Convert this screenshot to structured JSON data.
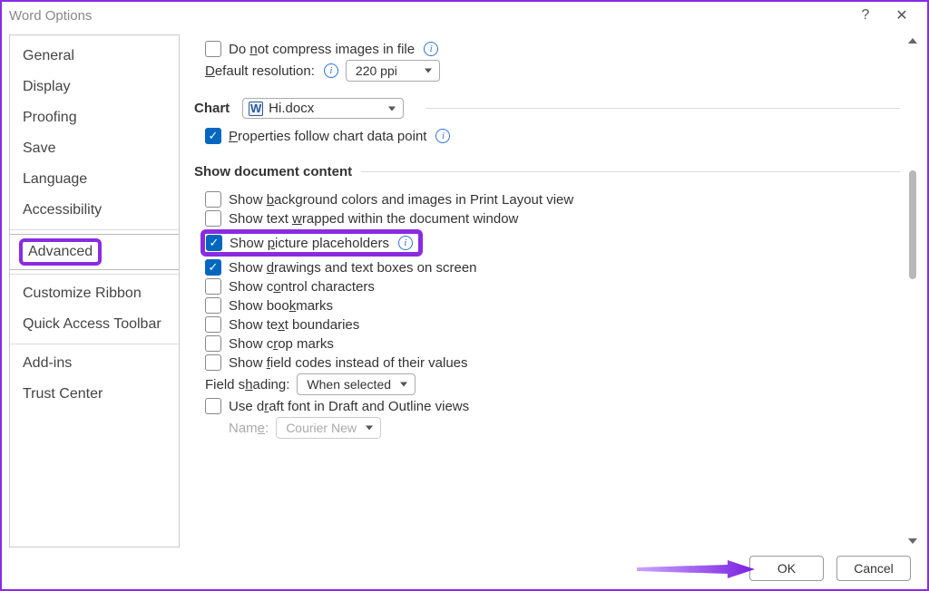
{
  "title": "Word Options",
  "titlebar": {
    "help": "?",
    "close": "✕"
  },
  "sidebar": {
    "items": [
      {
        "label": "General"
      },
      {
        "label": "Display"
      },
      {
        "label": "Proofing"
      },
      {
        "label": "Save"
      },
      {
        "label": "Language"
      },
      {
        "label": "Accessibility"
      },
      {
        "label": "Advanced",
        "selected": true,
        "highlighted": true
      },
      {
        "label": "Customize Ribbon"
      },
      {
        "label": "Quick Access Toolbar"
      },
      {
        "label": "Add-ins"
      },
      {
        "label": "Trust Center"
      }
    ]
  },
  "content": {
    "compress": {
      "label_prefix": "Do ",
      "label_accel": "n",
      "label_suffix": "ot compress images in file"
    },
    "default_res": {
      "label_accel": "D",
      "label_rest": "efault resolution:",
      "value": "220 ppi"
    },
    "chart_section": {
      "title": "Chart",
      "doc": "Hi.docx",
      "prop_prefix": "",
      "prop_accel": "P",
      "prop_rest": "roperties follow chart data point"
    },
    "doc_content_title": "Show document content",
    "checks": {
      "bg": {
        "pre": "Show ",
        "acc": "b",
        "post": "ackground colors and images in Print Layout view"
      },
      "wrap": {
        "pre": "Show text ",
        "acc": "w",
        "post": "rapped within the document window"
      },
      "pic": {
        "pre": "Show ",
        "acc": "p",
        "post": "icture placeholders"
      },
      "draw": {
        "pre": "Show ",
        "acc": "d",
        "post": "rawings and text boxes on screen"
      },
      "ctrl": {
        "pre": "Show c",
        "acc": "o",
        "post": "ntrol characters"
      },
      "bkmk": {
        "pre": "Show boo",
        "acc": "k",
        "post": "marks"
      },
      "bound": {
        "pre": "Show te",
        "acc": "x",
        "post": "t boundaries"
      },
      "crop": {
        "pre": "Show c",
        "acc": "r",
        "post": "op marks"
      },
      "field": {
        "pre": "Show ",
        "acc": "f",
        "post": "ield codes instead of their values"
      }
    },
    "field_shading": {
      "label_pre": "Field s",
      "label_acc": "h",
      "label_post": "ading:",
      "value": "When selected"
    },
    "draft_font": {
      "pre": "Use d",
      "acc": "r",
      "post": "aft font in Draft and Outline views"
    },
    "font_name": {
      "label_pre": "Nam",
      "label_acc": "e",
      "label_post": ":",
      "value": "Courier New"
    }
  },
  "footer": {
    "ok": "OK",
    "cancel": "Cancel"
  }
}
